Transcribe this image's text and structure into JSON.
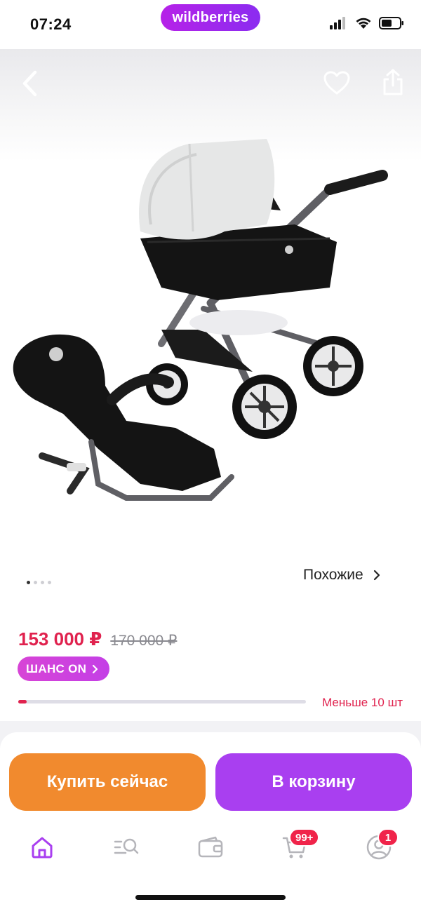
{
  "status_bar": {
    "time": "07:24",
    "brand": "wildberries"
  },
  "header": {
    "back_icon": "chevron-left-icon",
    "favorite_icon": "heart-icon",
    "share_icon": "share-icon"
  },
  "gallery": {
    "total_images": 4,
    "active_index": 0
  },
  "similar": {
    "label": "Похожие"
  },
  "price": {
    "current": "153 000 ₽",
    "old": "170 000 ₽"
  },
  "promo": {
    "label": "ШАНС ON"
  },
  "stock": {
    "label": "Меньше 10 шт",
    "fill_fraction": 0.03
  },
  "actions": {
    "buy_now": "Купить сейчас",
    "add_to_cart": "В корзину"
  },
  "tabbar": {
    "items": [
      {
        "name": "home",
        "icon": "home-icon",
        "active": true
      },
      {
        "name": "catalog",
        "icon": "catalog-search-icon"
      },
      {
        "name": "wallet",
        "icon": "wallet-icon"
      },
      {
        "name": "cart",
        "icon": "cart-icon",
        "badge": "99+"
      },
      {
        "name": "profile",
        "icon": "profile-icon",
        "badge": "1"
      }
    ]
  },
  "colors": {
    "accent": "#a93ff0",
    "price": "#e0224e",
    "buy": "#f18a2e",
    "brand_gradient": [
      "#b622e8",
      "#8b2cf0"
    ]
  }
}
